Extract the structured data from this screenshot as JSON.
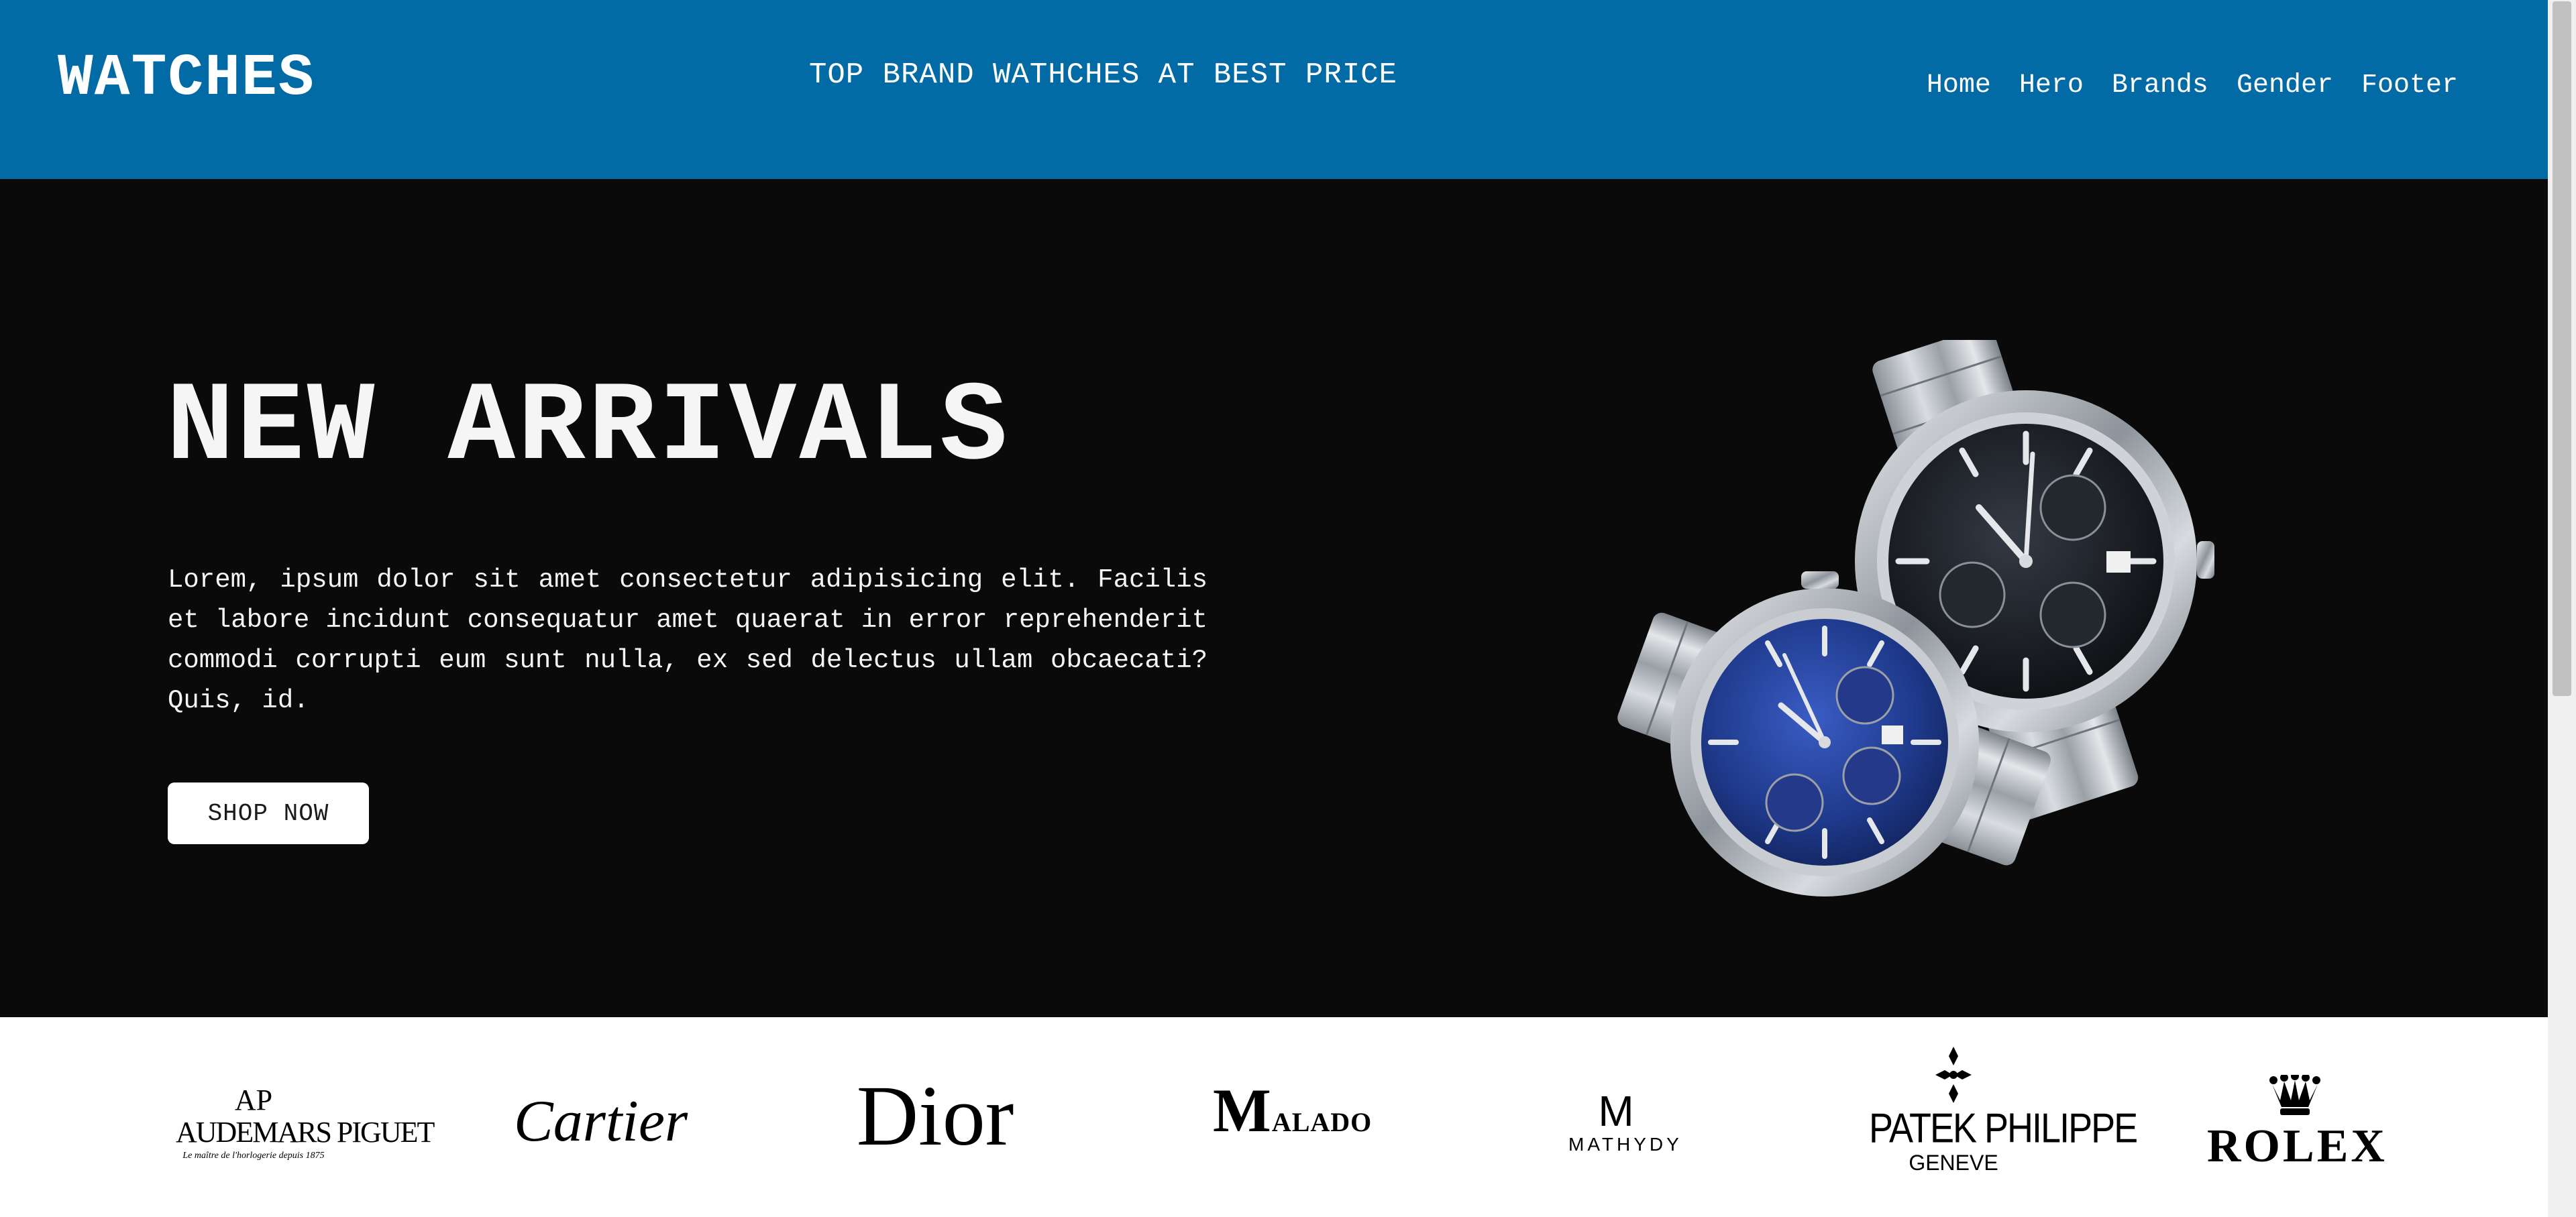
{
  "header": {
    "logo": "WATCHES",
    "tagline": "TOP BRAND WATHCHES AT BEST PRICE",
    "nav": [
      {
        "label": "Home"
      },
      {
        "label": "Hero"
      },
      {
        "label": "Brands"
      },
      {
        "label": "Gender"
      },
      {
        "label": "Footer"
      }
    ]
  },
  "hero": {
    "title": "NEW ARRIVALS",
    "text": "Lorem, ipsum dolor sit amet consectetur adipisicing elit. Facilis et labore incidunt consequatur amet quaerat in error reprehenderit commodi corrupti eum sunt nulla, ex sed delectus ullam obcaecati? Quis, id.",
    "button_label": "SHOP NOW",
    "image_icon": "wristwatch-pair"
  },
  "brands": {
    "audemars": {
      "mark": "AP",
      "name": "AUDEMARS PIGUET",
      "sub": "Le maître de l'horlogerie depuis 1875"
    },
    "cartier": "Cartier",
    "dior": "Dior",
    "malado": {
      "initial": "M",
      "rest": "ALADO"
    },
    "mathydy": {
      "mark": "M",
      "name": "MATHYDY"
    },
    "patek": {
      "name": "PATEK PHILIPPE",
      "city": "GENEVE"
    },
    "rolex": "ROLEX"
  },
  "colors": {
    "header_bg": "#026ba6",
    "hero_bg": "#0a0a0a",
    "watch_left_dial": "#1f3a8c",
    "watch_right_dial": "#1b1e24",
    "steel": "#b7bcc2"
  }
}
